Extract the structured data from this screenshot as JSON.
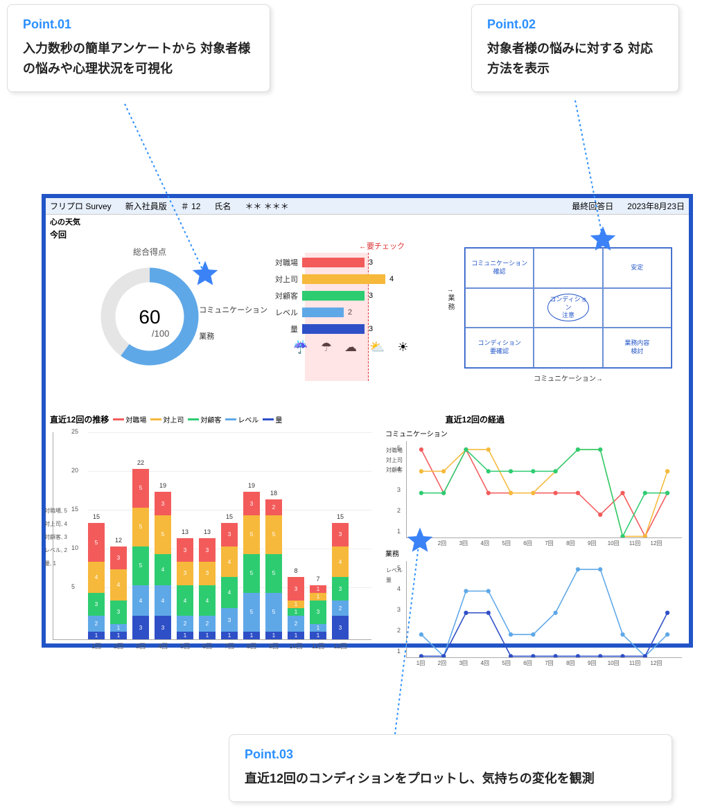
{
  "callouts": {
    "p1": {
      "label": "Point.01",
      "text": "入力数秒の簡単アンケートから\n対象者様の悩みや心理状況を可視化"
    },
    "p2": {
      "label": "Point.02",
      "text": "対象者様の悩みに対する\n対応方法を表示"
    },
    "p3": {
      "label": "Point.03",
      "text": "直近12回のコンディションをプロットし、気持ちの変化を観測"
    }
  },
  "header": {
    "app": "フリプロ Survey",
    "edition": "新入社員版",
    "id_label": "＃",
    "id_value": "12",
    "name_label": "氏名",
    "name_value": "＊＊ ＊＊＊",
    "date_label": "最終回答日",
    "date_value": "2023年8月23日"
  },
  "sections": {
    "weather": "心の天気",
    "this_time": "今回",
    "trend_title": "直近12回の推移",
    "progress_title": "直近12回の経過"
  },
  "gauge": {
    "title": "総合得点",
    "value": "60",
    "denom": "/100",
    "side1": "コミュニケーション",
    "side2": "業務"
  },
  "hbars": {
    "check_label": "←要チェック",
    "labels": [
      "対職場",
      "対上司",
      "対顧客",
      "レベル",
      "量"
    ],
    "max": 5
  },
  "weather_icons": [
    "rain-heavy",
    "umbrella",
    "cloud",
    "sun-partial",
    "sun"
  ],
  "matrix": {
    "cells": [
      "コミュニケーション\n確認",
      "",
      "安定",
      "",
      "コンディション\n注意",
      "",
      "コンディション\n要確認",
      "",
      "業務内容\n検討"
    ],
    "y_axis": "↑\n業\n務",
    "x_axis": "コミュニケーション→"
  },
  "legend": {
    "items": [
      {
        "name": "対職場",
        "color": "#f35b5b"
      },
      {
        "name": "対上司",
        "color": "#f6b93b"
      },
      {
        "name": "対顧客",
        "color": "#2ecc71"
      },
      {
        "name": "レベル",
        "color": "#5fa8e8"
      },
      {
        "name": "量",
        "color": "#2f4fc7"
      }
    ]
  },
  "lines": {
    "comm_title": "コミュニケーション",
    "work_title": "業務",
    "comm_legend": [
      "対職場",
      "対上司",
      "対顧客"
    ],
    "work_legend": [
      "レベル",
      "量"
    ]
  },
  "side_labels": [
    "対職場, 5",
    "対上司, 4",
    "対顧客, 3",
    "レベル, 2",
    "量, 1"
  ],
  "chart_data": {
    "gauge": {
      "type": "gauge",
      "value": 60,
      "max": 100
    },
    "current_bars": {
      "type": "bar",
      "orientation": "horizontal",
      "categories": [
        "対職場",
        "対上司",
        "対顧客",
        "レベル",
        "量"
      ],
      "values": [
        3,
        4,
        3,
        2,
        3
      ],
      "colors": [
        "#f35b5b",
        "#f6b93b",
        "#2ecc71",
        "#5fa8e8",
        "#2f4fc7"
      ],
      "xlim": [
        0,
        5
      ],
      "check_threshold": 3,
      "annotation": "←要チェック"
    },
    "stacked_trend": {
      "type": "bar",
      "stacked": true,
      "categories": [
        "1回",
        "2回",
        "3回",
        "4回",
        "5回",
        "6回",
        "7回",
        "8回",
        "9回",
        "10回",
        "11回",
        "12回"
      ],
      "series": [
        {
          "name": "対職場",
          "color": "#f35b5b",
          "values": [
            5,
            3,
            5,
            3,
            3,
            3,
            3,
            3,
            2,
            3,
            1,
            3
          ]
        },
        {
          "name": "対上司",
          "color": "#f6b93b",
          "values": [
            4,
            4,
            5,
            5,
            3,
            3,
            4,
            5,
            5,
            1,
            1,
            4
          ]
        },
        {
          "name": "対顧客",
          "color": "#2ecc71",
          "values": [
            3,
            3,
            5,
            4,
            4,
            4,
            4,
            5,
            5,
            1,
            3,
            3
          ]
        },
        {
          "name": "レベル",
          "color": "#5fa8e8",
          "values": [
            2,
            1,
            4,
            4,
            2,
            2,
            3,
            5,
            5,
            2,
            1,
            2
          ]
        },
        {
          "name": "量",
          "color": "#2f4fc7",
          "values": [
            1,
            1,
            3,
            3,
            1,
            1,
            1,
            1,
            1,
            1,
            1,
            3
          ]
        }
      ],
      "totals": [
        15,
        12,
        22,
        19,
        13,
        13,
        15,
        19,
        18,
        8,
        7,
        15
      ],
      "ylim": [
        0,
        25
      ],
      "yticks": [
        5,
        10,
        15,
        20,
        25
      ]
    },
    "comm_lines": {
      "type": "line",
      "x": [
        "1回",
        "2回",
        "3回",
        "4回",
        "5回",
        "6回",
        "7回",
        "8回",
        "9回",
        "10回",
        "11回",
        "12回"
      ],
      "series": [
        {
          "name": "対職場",
          "color": "#f35b5b",
          "values": [
            5,
            3,
            5,
            3,
            3,
            3,
            3,
            3,
            2,
            3,
            1,
            3
          ]
        },
        {
          "name": "対上司",
          "color": "#f6b93b",
          "values": [
            4,
            4,
            5,
            5,
            3,
            3,
            4,
            5,
            5,
            1,
            1,
            4
          ]
        },
        {
          "name": "対顧客",
          "color": "#2ecc71",
          "values": [
            3,
            3,
            5,
            4,
            4,
            4,
            4,
            5,
            5,
            1,
            3,
            3
          ]
        }
      ],
      "ylim": [
        1,
        5
      ]
    },
    "work_lines": {
      "type": "line",
      "x": [
        "1回",
        "2回",
        "3回",
        "4回",
        "5回",
        "6回",
        "7回",
        "8回",
        "9回",
        "10回",
        "11回",
        "12回"
      ],
      "series": [
        {
          "name": "レベル",
          "color": "#5fa8e8",
          "values": [
            2,
            1,
            4,
            4,
            2,
            2,
            3,
            5,
            5,
            2,
            1,
            2
          ]
        },
        {
          "name": "量",
          "color": "#2f4fc7",
          "values": [
            1,
            1,
            3,
            3,
            1,
            1,
            1,
            1,
            1,
            1,
            1,
            3
          ]
        }
      ],
      "ylim": [
        1,
        5
      ]
    }
  }
}
